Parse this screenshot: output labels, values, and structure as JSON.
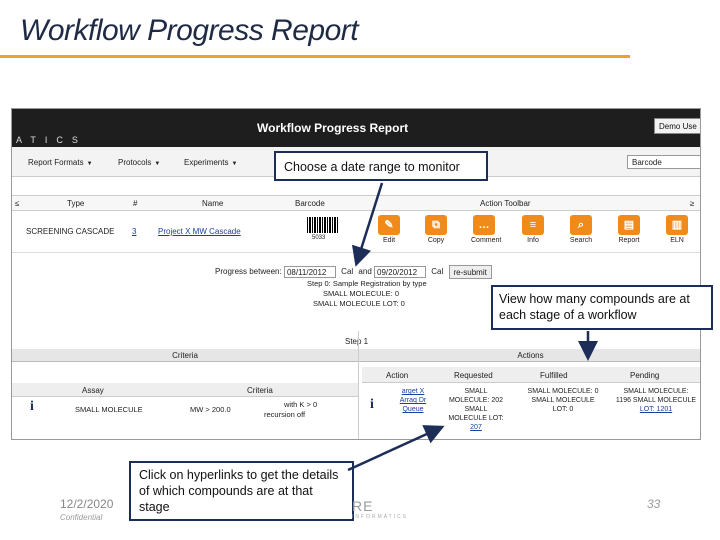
{
  "slide": {
    "title": "Workflow Progress Report",
    "date": "12/2/2020",
    "confidential": "Confidential",
    "page_number": "33",
    "logo_text": "RE",
    "logo_subtext": "INFORMATICS"
  },
  "app": {
    "brand": "ATICS",
    "title": "Workflow Progress Report",
    "user_button": "Demo Use",
    "menu": [
      {
        "label": "Report Formats"
      },
      {
        "label": "Protocols"
      },
      {
        "label": "Experiments"
      }
    ],
    "barcode_select": "Barcode",
    "columns": {
      "type": "Type",
      "num": "#",
      "name": "Name",
      "barcode": "Barcode",
      "action_toolbar": "Action Toolbar"
    },
    "row": {
      "type": "SCREENING CASCADE",
      "num": "3",
      "name": "Project X MW Cascade",
      "barcode_number": "5033"
    },
    "toolbar": [
      {
        "label": "Edit",
        "icon": "edit-icon"
      },
      {
        "label": "Copy",
        "icon": "copy-icon"
      },
      {
        "label": "Comment",
        "icon": "comment-icon"
      },
      {
        "label": "Info",
        "icon": "info-icon"
      },
      {
        "label": "Search",
        "icon": "search-icon"
      },
      {
        "label": "Report",
        "icon": "report-icon"
      },
      {
        "label": "ELN",
        "icon": "eln-icon"
      }
    ],
    "progress": {
      "label": "Progress between:",
      "start_date": "08/11/2012",
      "start_cal": "Cal",
      "and_label": "and",
      "end_date": "09/20/2012",
      "end_cal": "Cal",
      "resubmit": "re-submit"
    },
    "step0": {
      "line1": "Step 0:  Sample Registration by type",
      "line2": "SMALL MOLECULE: 0",
      "line3": "SMALL MOLECULE LOT: 0"
    },
    "step1_label": "Step 1",
    "criteria_label": "Criteria",
    "actions_label": "Actions",
    "criteria_columns": {
      "assay": "Assay",
      "criteria": "Criteria"
    },
    "criteria_row": {
      "assay": "SMALL MOLECULE",
      "criteria": "MW  > 200.0",
      "extra1": "with K > 0",
      "extra2": "recursion off"
    },
    "action_columns": {
      "action": "Action",
      "requested": "Requested",
      "fulfilled": "Fulfilled",
      "pending": "Pending"
    },
    "action_row": {
      "action1": "arget X",
      "action2": "Arraq Dr",
      "action3": "Queue",
      "requested1": "SMALL",
      "requested2": "MOLECULE: 202",
      "requested3": "SMALL",
      "requested4": "MOLECULE LOT:",
      "requested5": "207",
      "fulfilled1": "SMALL MOLECULE: 0",
      "fulfilled2": "SMALL MOLECULE",
      "fulfilled3": "LOT: 0",
      "pending1": "SMALL MOLECULE:",
      "pending2": "1196 SMALL MOLECULE",
      "pending3": "LOT: 1201"
    }
  },
  "callouts": {
    "date_range": "Choose a date range to monitor",
    "compounds_stage": "View how many compounds are at each stage of a workflow",
    "hyperlinks": "Click on hyperlinks to get the details of which compounds are at that stage"
  },
  "colors": {
    "accent_orange": "#f0a030",
    "callout_border": "#1c2d57",
    "toolbar_orange": "#f08a1a"
  }
}
